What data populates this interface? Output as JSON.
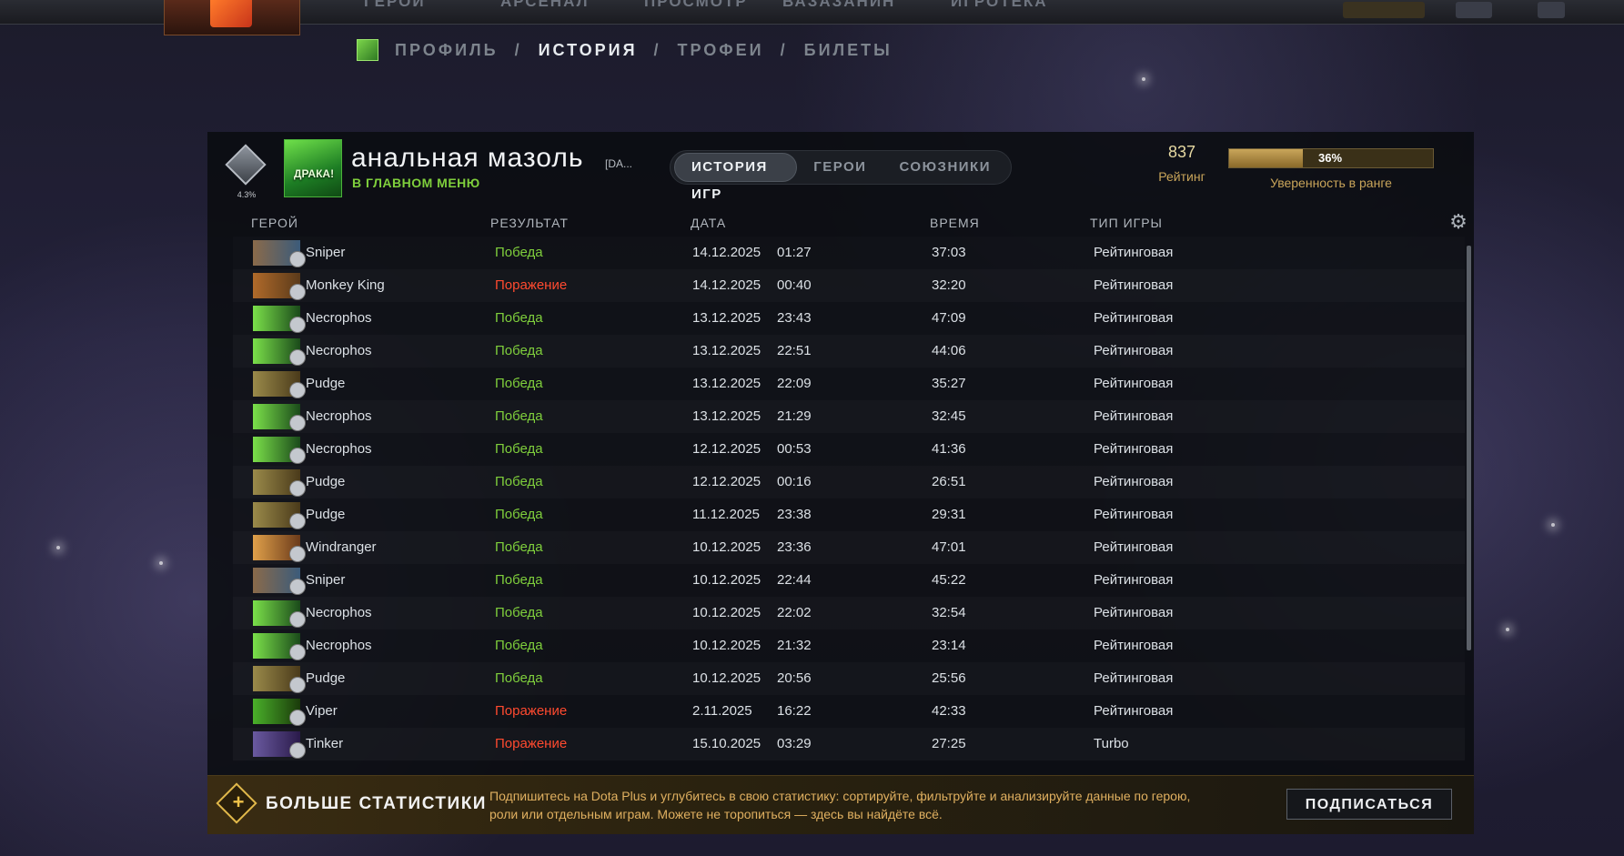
{
  "top_nav": {
    "items": [
      "ГЕРОИ",
      "АРСЕНАЛ",
      "ПРОСМОТР",
      "ВАЗАЗАНИН",
      "ИГРОТЕКА"
    ]
  },
  "breadcrumb": {
    "profile": "ПРОФИЛЬ",
    "sep1": "/",
    "history": "ИСТОРИЯ",
    "sep2": "/",
    "trophies": "ТРОФЕИ",
    "sep3": "/",
    "tickets": "БИЛЕТЫ"
  },
  "player": {
    "name": "анальная мазоль",
    "tag": "[DA...",
    "status": "В ГЛАВНОМ МЕНЮ",
    "avatar_text": "ДРАКА!",
    "rank_percent": "4.3%"
  },
  "tabs": {
    "history": "ИСТОРИЯ ИГР",
    "heroes": "ГЕРОИ",
    "allies": "СОЮЗНИКИ"
  },
  "stats": {
    "rating_value": "837",
    "rating_label": "Рейтинг",
    "confidence_value": "36%",
    "confidence_fraction": 0.36,
    "confidence_label": "Уверенность в ранге"
  },
  "table": {
    "headers": {
      "hero": "ГЕРОЙ",
      "result": "РЕЗУЛЬТАТ",
      "date": "ДАТА",
      "duration": "ВРЕМЯ",
      "type": "ТИП ИГРЫ"
    },
    "rows": [
      {
        "hero": "Sniper",
        "result": "Победа",
        "date": "14.12.2025",
        "time": "01:27",
        "duration": "37:03",
        "type": "Рейтинговая"
      },
      {
        "hero": "Monkey King",
        "result": "Поражение",
        "date": "14.12.2025",
        "time": "00:40",
        "duration": "32:20",
        "type": "Рейтинговая"
      },
      {
        "hero": "Necrophos",
        "result": "Победа",
        "date": "13.12.2025",
        "time": "23:43",
        "duration": "47:09",
        "type": "Рейтинговая"
      },
      {
        "hero": "Necrophos",
        "result": "Победа",
        "date": "13.12.2025",
        "time": "22:51",
        "duration": "44:06",
        "type": "Рейтинговая"
      },
      {
        "hero": "Pudge",
        "result": "Победа",
        "date": "13.12.2025",
        "time": "22:09",
        "duration": "35:27",
        "type": "Рейтинговая"
      },
      {
        "hero": "Necrophos",
        "result": "Победа",
        "date": "13.12.2025",
        "time": "21:29",
        "duration": "32:45",
        "type": "Рейтинговая"
      },
      {
        "hero": "Necrophos",
        "result": "Победа",
        "date": "12.12.2025",
        "time": "00:53",
        "duration": "41:36",
        "type": "Рейтинговая"
      },
      {
        "hero": "Pudge",
        "result": "Победа",
        "date": "12.12.2025",
        "time": "00:16",
        "duration": "26:51",
        "type": "Рейтинговая"
      },
      {
        "hero": "Pudge",
        "result": "Победа",
        "date": "11.12.2025",
        "time": "23:38",
        "duration": "29:31",
        "type": "Рейтинговая"
      },
      {
        "hero": "Windranger",
        "result": "Победа",
        "date": "10.12.2025",
        "time": "23:36",
        "duration": "47:01",
        "type": "Рейтинговая"
      },
      {
        "hero": "Sniper",
        "result": "Победа",
        "date": "10.12.2025",
        "time": "22:44",
        "duration": "45:22",
        "type": "Рейтинговая"
      },
      {
        "hero": "Necrophos",
        "result": "Победа",
        "date": "10.12.2025",
        "time": "22:02",
        "duration": "32:54",
        "type": "Рейтинговая"
      },
      {
        "hero": "Necrophos",
        "result": "Победа",
        "date": "10.12.2025",
        "time": "21:32",
        "duration": "23:14",
        "type": "Рейтинговая"
      },
      {
        "hero": "Pudge",
        "result": "Победа",
        "date": "10.12.2025",
        "time": "20:56",
        "duration": "25:56",
        "type": "Рейтинговая"
      },
      {
        "hero": "Viper",
        "result": "Поражение",
        "date": "2.11.2025",
        "time": "16:22",
        "duration": "42:33",
        "type": "Рейтинговая"
      },
      {
        "hero": "Tinker",
        "result": "Поражение",
        "date": "15.10.2025",
        "time": "03:29",
        "duration": "27:25",
        "type": "Turbo"
      }
    ]
  },
  "hero_colors": {
    "Sniper": [
      "#8a6a4a",
      "#3b5b7a"
    ],
    "Monkey King": [
      "#b06a2a",
      "#5a3a1a"
    ],
    "Necrophos": [
      "#7be04a",
      "#1a4a1a"
    ],
    "Pudge": [
      "#9a8a4a",
      "#4a3a1a"
    ],
    "Windranger": [
      "#e0a04a",
      "#6a3a1a"
    ],
    "Viper": [
      "#4ab02a",
      "#1a3a0a"
    ],
    "Tinker": [
      "#6a5aa0",
      "#2a1a4a"
    ]
  },
  "footer": {
    "title": "БОЛЬШЕ СТАТИСТИКИ",
    "description": "Подпишитесь на Dota Plus и углубитесь в свою статистику: сортируйте, фильтруйте и анализируйте данные по герою, роли или отдельным играм. Можете не торопиться — здесь вы найдёте всё.",
    "button": "ПОДПИСАТЬСЯ"
  },
  "colors": {
    "win": "#7fcf3c",
    "loss": "#ff4a2f",
    "accent_gold": "#c9a55a"
  }
}
